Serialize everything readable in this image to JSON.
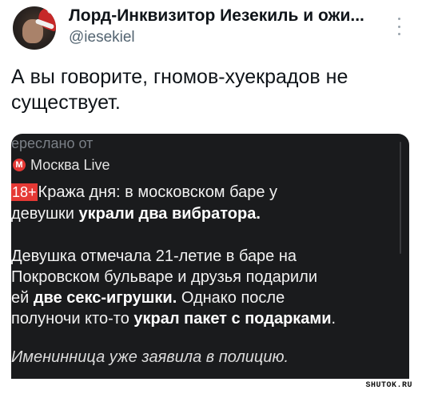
{
  "tweet": {
    "display_name": "Лорд-Инквизитор Иезекиль и ожи...",
    "handle": "@iesekiel",
    "text_line1": "А вы говорите, гномов-хуекрадов не",
    "text_line2": "существует."
  },
  "forwarded": {
    "label": "ереслано от",
    "channel_logo": "М",
    "channel_name": "Москва Live",
    "age_badge": "18+",
    "line1": "Кража дня: в московском баре у",
    "line2_plain": "девушки ",
    "line2_bold": "украли два вибратора.",
    "line3": "Девушка отмечала 21-летие в баре на",
    "line4": "Покровском бульваре и друзья подарили",
    "line5_plain1": "ей ",
    "line5_bold": "две секс-игрушки.",
    "line5_plain2": " Однако после",
    "line6_plain": "полуночи кто-то ",
    "line6_bold": "украл пакет с подарками",
    "line6_end": ".",
    "line7": "Именинница уже заявила в полицию."
  },
  "watermark": "SHUTOK.RU",
  "icons": {
    "more": "more-vertical-icon",
    "channel_logo": "moscow-live-logo-icon"
  },
  "colors": {
    "media_bg": "#1a1b1d",
    "badge_red": "#e53935",
    "handle_gray": "#536471"
  }
}
